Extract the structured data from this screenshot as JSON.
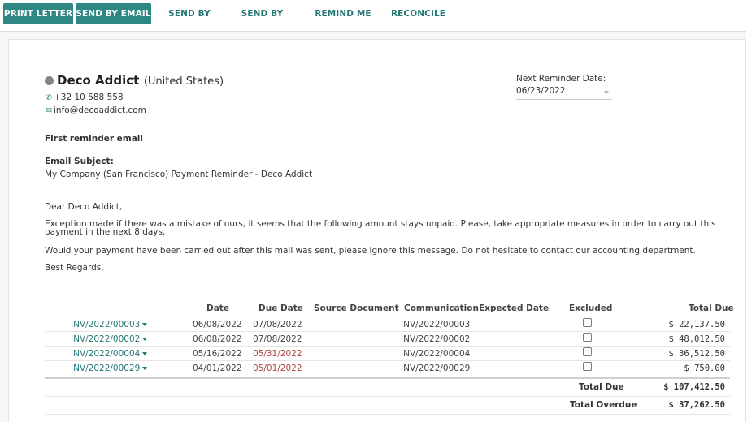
{
  "toolbar": {
    "print_letter": "PRINT LETTER",
    "send_by_email": "SEND BY EMAIL",
    "send_by_post": "SEND BY POST",
    "send_by_sms": "SEND BY SMS",
    "remind_me_later": "REMIND ME LATER",
    "reconcile": "RECONCILE"
  },
  "partner": {
    "name": "Deco Addict",
    "country": "(United States)",
    "phone": "+32 10 588 558",
    "email": "info@decoaddict.com"
  },
  "reminder": {
    "label": "Next Reminder Date:",
    "date": "06/23/2022"
  },
  "letter": {
    "level": "First reminder email",
    "subject_label": "Email Subject:",
    "subject": "My Company (San Francisco) Payment Reminder - Deco Addict",
    "greeting": "Dear Deco Addict,",
    "paragraph1": "Exception made if there was a mistake of ours, it seems that the following amount stays unpaid. Please, take appropriate measures in order to carry out this payment in the next 8 days.",
    "paragraph2": "Would your payment have been carried out after this mail was sent, please ignore this message. Do not hesitate to contact our accounting department.",
    "closing": "Best Regards,"
  },
  "table": {
    "headers": {
      "date": "Date",
      "due_date": "Due Date",
      "source_document": "Source Document",
      "communication": "Communication",
      "expected_date": "Expected Date",
      "excluded": "Excluded",
      "total_due": "Total Due"
    },
    "rows": [
      {
        "invoice": "INV/2022/00003",
        "date": "06/08/2022",
        "due_date": "07/08/2022",
        "overdue": false,
        "communication": "INV/2022/00003",
        "excluded": false,
        "total": "$ 22,137.50"
      },
      {
        "invoice": "INV/2022/00002",
        "date": "06/08/2022",
        "due_date": "07/08/2022",
        "overdue": false,
        "communication": "INV/2022/00002",
        "excluded": false,
        "total": "$ 48,012.50"
      },
      {
        "invoice": "INV/2022/00004",
        "date": "05/16/2022",
        "due_date": "05/31/2022",
        "overdue": true,
        "communication": "INV/2022/00004",
        "excluded": false,
        "total": "$ 36,512.50"
      },
      {
        "invoice": "INV/2022/00029",
        "date": "04/01/2022",
        "due_date": "05/01/2022",
        "overdue": true,
        "communication": "INV/2022/00029",
        "excluded": false,
        "total": "$ 750.00"
      }
    ],
    "total_due_label": "Total Due",
    "total_due_value": "$ 107,412.50",
    "total_overdue_label": "Total Overdue",
    "total_overdue_value": "$ 37,262.50"
  },
  "colors": {
    "primary": "#2e8782",
    "link": "#247874",
    "overdue": "#a94442"
  }
}
